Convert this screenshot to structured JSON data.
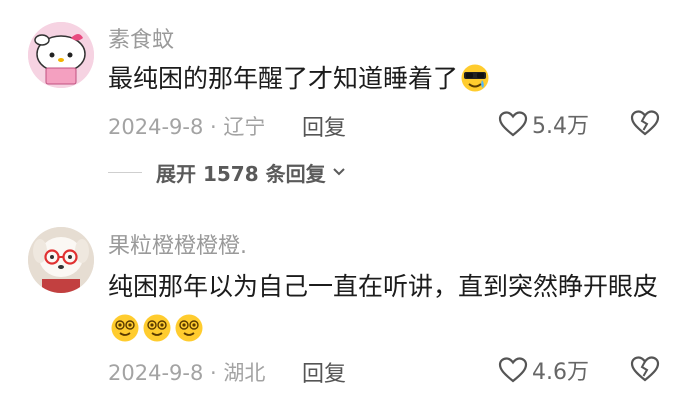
{
  "comments": [
    {
      "username": "素食蚊",
      "text": "最纯困的那年醒了才知道睡着了",
      "emoji": [
        "crying-sunglasses-emoji"
      ],
      "date_location": "2024-9-8 · 辽宁",
      "reply_label": "回复",
      "like_count": "5.4万",
      "expand_label": "展开 1578 条回复"
    },
    {
      "username": "果粒橙橙橙橙.",
      "text": "纯困那年以为自己一直在听讲，直到突然睁开眼皮",
      "emoji": [
        "dizzy-face-emoji",
        "dizzy-face-emoji",
        "dizzy-face-emoji"
      ],
      "date_location": "2024-9-8 · 湖北",
      "reply_label": "回复",
      "like_count": "4.6万"
    }
  ],
  "colors": {
    "username": "#9a9a9a",
    "text": "#1c1c1c",
    "meta": "#a3a3a3",
    "emoji_yellow": "#ffcc2e"
  }
}
